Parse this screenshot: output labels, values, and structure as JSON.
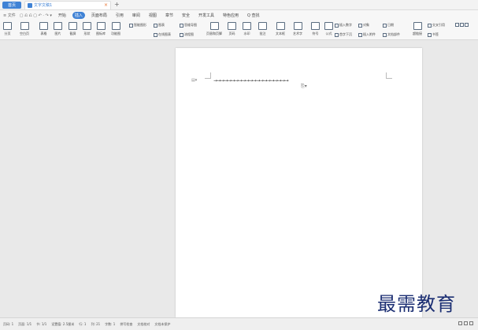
{
  "tabs": {
    "home": "首页",
    "document": "文字文稿1",
    "close": "×",
    "new": "+"
  },
  "menu": {
    "file": "≡ 文件",
    "quick_access": "▢ ⎌ ⎌ ▢ ↶ · ↷ ▾",
    "items": [
      "开始",
      "插入",
      "页面布局",
      "引用",
      "审阅",
      "视图",
      "章节",
      "安全",
      "开发工具",
      "特色应用",
      "Q 查找"
    ],
    "active_index": 1
  },
  "ribbon": {
    "large_buttons": [
      "分页",
      "空白页",
      "表格",
      "图片",
      "截屏",
      "形状",
      "图标库",
      "功能图",
      "页眉和页脚",
      "页码",
      "水印",
      "批注",
      "文本框",
      "艺术字",
      "符号",
      "公式",
      "超链接",
      "书签"
    ],
    "small_buttons": [
      "智能图形",
      "图表",
      "在线图表",
      "流程图",
      "思维导图",
      "插入数字",
      "对象",
      "首字下沉",
      "插入附件",
      "文档部件",
      "日期",
      "交叉引用",
      "文本框"
    ]
  },
  "document": {
    "paragraph_marker": "▤▾",
    "arrow_line": "→→→→→→→→→→→→→→→→→→→→→",
    "paste_options": "⎘▾"
  },
  "status": {
    "items": [
      "页码: 1",
      "页面: 1/1",
      "节: 1/1",
      "设置值: 2.5厘米",
      "行: 1",
      "列: 21",
      "字数: 1",
      "拼写检查",
      "文档校对",
      "文档未保护"
    ]
  },
  "watermark": "最需教育",
  "colors": {
    "accent": "#3f82d5",
    "watermark": "#1c2f73"
  }
}
